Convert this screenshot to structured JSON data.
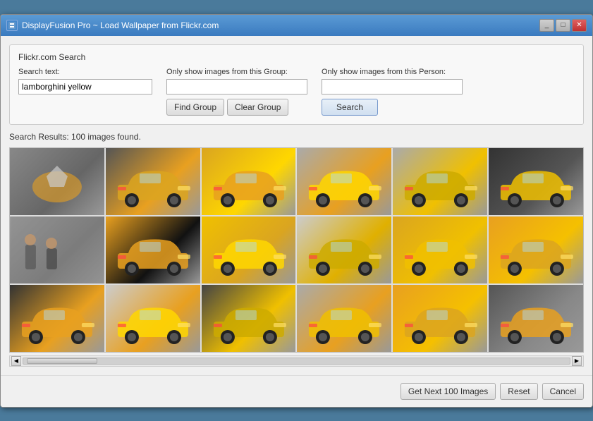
{
  "window": {
    "title": "DisplayFusion Pro ~ Load Wallpaper from Flickr.com",
    "icon": "DF"
  },
  "search_section": {
    "label": "Flickr.com Search",
    "search_text_label": "Search text:",
    "search_text_value": "lamborghini yellow",
    "search_text_placeholder": "",
    "group_label": "Only show images from this Group:",
    "group_value": "",
    "person_label": "Only show images from this Person:",
    "person_value": "",
    "find_group_label": "Find Group",
    "clear_group_label": "Clear Group",
    "search_label": "Search"
  },
  "results": {
    "label": "Search Results: 100 images found.",
    "images": [
      {
        "id": 1,
        "theme": "img-1"
      },
      {
        "id": 2,
        "theme": "img-2"
      },
      {
        "id": 3,
        "theme": "img-3"
      },
      {
        "id": 4,
        "theme": "img-4"
      },
      {
        "id": 5,
        "theme": "img-5"
      },
      {
        "id": 6,
        "theme": "img-6"
      },
      {
        "id": 7,
        "theme": "img-7"
      },
      {
        "id": 8,
        "theme": "img-8"
      },
      {
        "id": 9,
        "theme": "img-9"
      },
      {
        "id": 10,
        "theme": "img-10"
      },
      {
        "id": 11,
        "theme": "img-11"
      },
      {
        "id": 12,
        "theme": "img-12"
      },
      {
        "id": 13,
        "theme": "img-13"
      },
      {
        "id": 14,
        "theme": "img-14"
      },
      {
        "id": 15,
        "theme": "img-15"
      },
      {
        "id": 16,
        "theme": "img-16"
      },
      {
        "id": 17,
        "theme": "img-17"
      },
      {
        "id": 18,
        "theme": "img-18"
      }
    ]
  },
  "footer": {
    "next_label": "Get Next 100 Images",
    "reset_label": "Reset",
    "cancel_label": "Cancel"
  }
}
